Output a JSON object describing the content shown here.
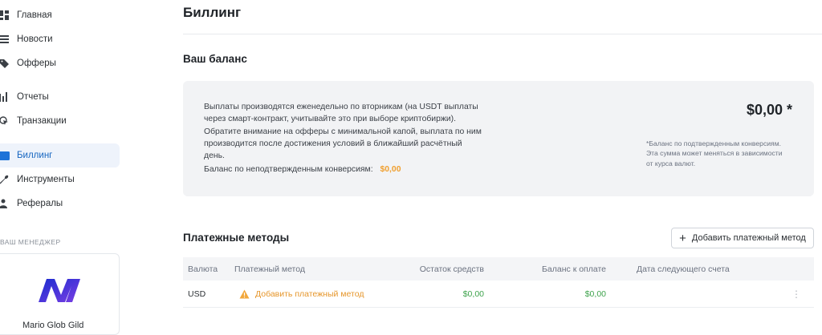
{
  "sidebar": {
    "items": [
      {
        "label": "Главная",
        "icon": "dashboard-icon"
      },
      {
        "label": "Новости",
        "icon": "news-icon"
      },
      {
        "label": "Офферы",
        "icon": "tag-icon"
      },
      {
        "label": "Отчеты",
        "icon": "bar-chart-icon"
      },
      {
        "label": "Транзакции",
        "icon": "pointer-click-icon"
      },
      {
        "label": "Биллинг",
        "icon": "credit-card-icon"
      },
      {
        "label": "Инструменты",
        "icon": "wrench-icon"
      },
      {
        "label": "Рефералы",
        "icon": "referral-icon"
      }
    ],
    "manager_label": "ВАШ МЕНЕДЖЕР",
    "manager_name": "Mario Glob Gild"
  },
  "page": {
    "title": "Биллинг"
  },
  "balance": {
    "section_title": "Ваш баланс",
    "info_text": "Выплаты производятся еженедельно по вторникам (на USDT выплаты через смарт-контракт, учитывайте это при выборе криптобиржи). Обратите внимание на офферы с минимальной капой, выплата по ним производится после достижения условий в ближайший расчётный день.",
    "unconfirmed_label": "Баланс по неподтвержденным конверсиям:",
    "unconfirmed_value": "$0,00",
    "amount": "$0,00 *",
    "note": "*Баланс по подтвержденным конверсиям. Эта сумма может меняться в зависимости от курса валют."
  },
  "payments": {
    "section_title": "Платежные методы",
    "add_button_label": "Добавить платежный метод",
    "columns": [
      "Валюта",
      "Платежный метод",
      "Остаток средств",
      "Баланс к оплате",
      "Дата следующего счета"
    ],
    "rows": [
      {
        "currency": "USD",
        "method": "Добавить платежный метод",
        "remaining": "$0,00",
        "payable": "$0,00",
        "next_date": ""
      }
    ]
  },
  "colors": {
    "accent": "#1e73d8",
    "warning": "#e6962b",
    "positive": "#3fa34d"
  }
}
